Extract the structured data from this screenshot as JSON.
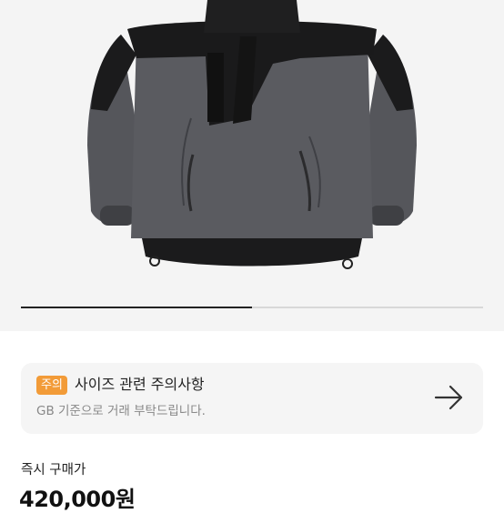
{
  "product": {
    "image_name": "black-grey-anorak-jacket",
    "carousel_progress": 0.5
  },
  "notice": {
    "badge": "주의",
    "title": "사이즈 관련 주의사항",
    "description": "GB 기준으로 거래 부탁드립니다.",
    "badge_color": "#f29b38"
  },
  "purchase": {
    "label": "즉시 구매가",
    "price": "420,000원"
  }
}
